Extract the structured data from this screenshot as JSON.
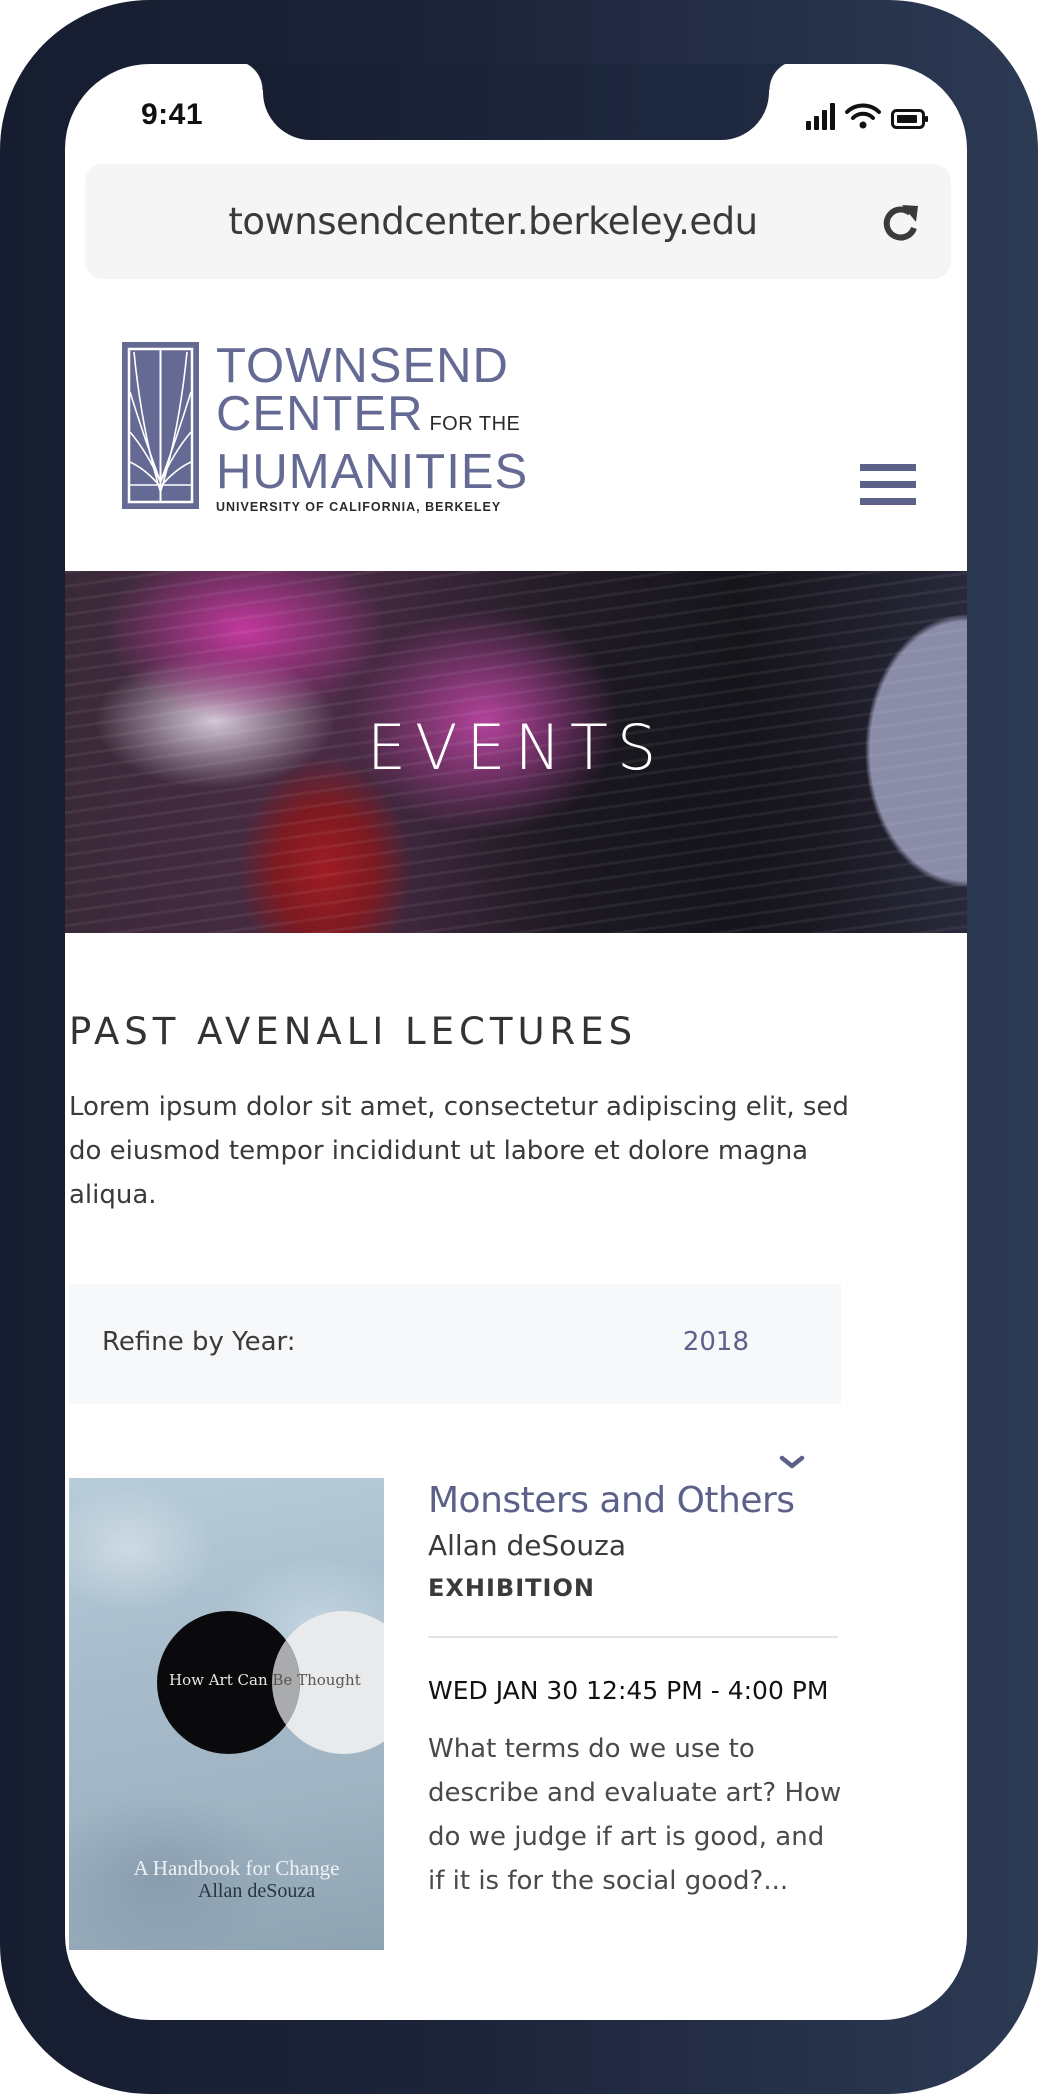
{
  "status_bar": {
    "time": "9:41",
    "icons": [
      "signal-icon",
      "wifi-icon",
      "battery-icon"
    ]
  },
  "browser": {
    "url": "townsendcenter.berkeley.edu",
    "reload_icon": "reload-icon"
  },
  "header": {
    "logo": {
      "line1": "TOWNSEND",
      "line2": "CENTER",
      "line2_small": "FOR THE",
      "line3": "HUMANITIES",
      "subtitle": "UNIVERSITY OF CALIFORNIA, BERKELEY",
      "mark_icon": "wheat-window-logo"
    },
    "menu_icon": "hamburger-menu-icon"
  },
  "hero": {
    "title": "EVENTS"
  },
  "main": {
    "section_title": "PAST AVENALI LECTURES",
    "intro": "Lorem ipsum dolor sit amet, consectetur adipiscing elit, sed do eiusmod tempor incididunt ut labore et dolore magna aliqua.",
    "filter": {
      "label": "Refine by Year:",
      "value": "2018",
      "icon": "chevron-down-icon"
    },
    "events": [
      {
        "cover": {
          "title_part1": "How Art Can",
          "title_part2": "Be",
          "title_part3": "Thought",
          "subtitle": "A Handbook for Change",
          "author": "Allan deSouza"
        },
        "title": "Monsters and Others",
        "speaker": "Allan deSouza",
        "type": "EXHIBITION",
        "datetime": "WED JAN 30 12:45 PM - 4:00 PM",
        "description": "What terms do we use to describe and evaluate art? How do we judge if art is good, and if it is for the social good?..."
      }
    ]
  },
  "colors": {
    "brand": "#646a93",
    "accent_text": "#5c618a",
    "frame_dark": "#161d30",
    "frame_light": "#2d3a54",
    "filter_bg": "#f7f8fa",
    "body_text": "#3a3a3a"
  }
}
